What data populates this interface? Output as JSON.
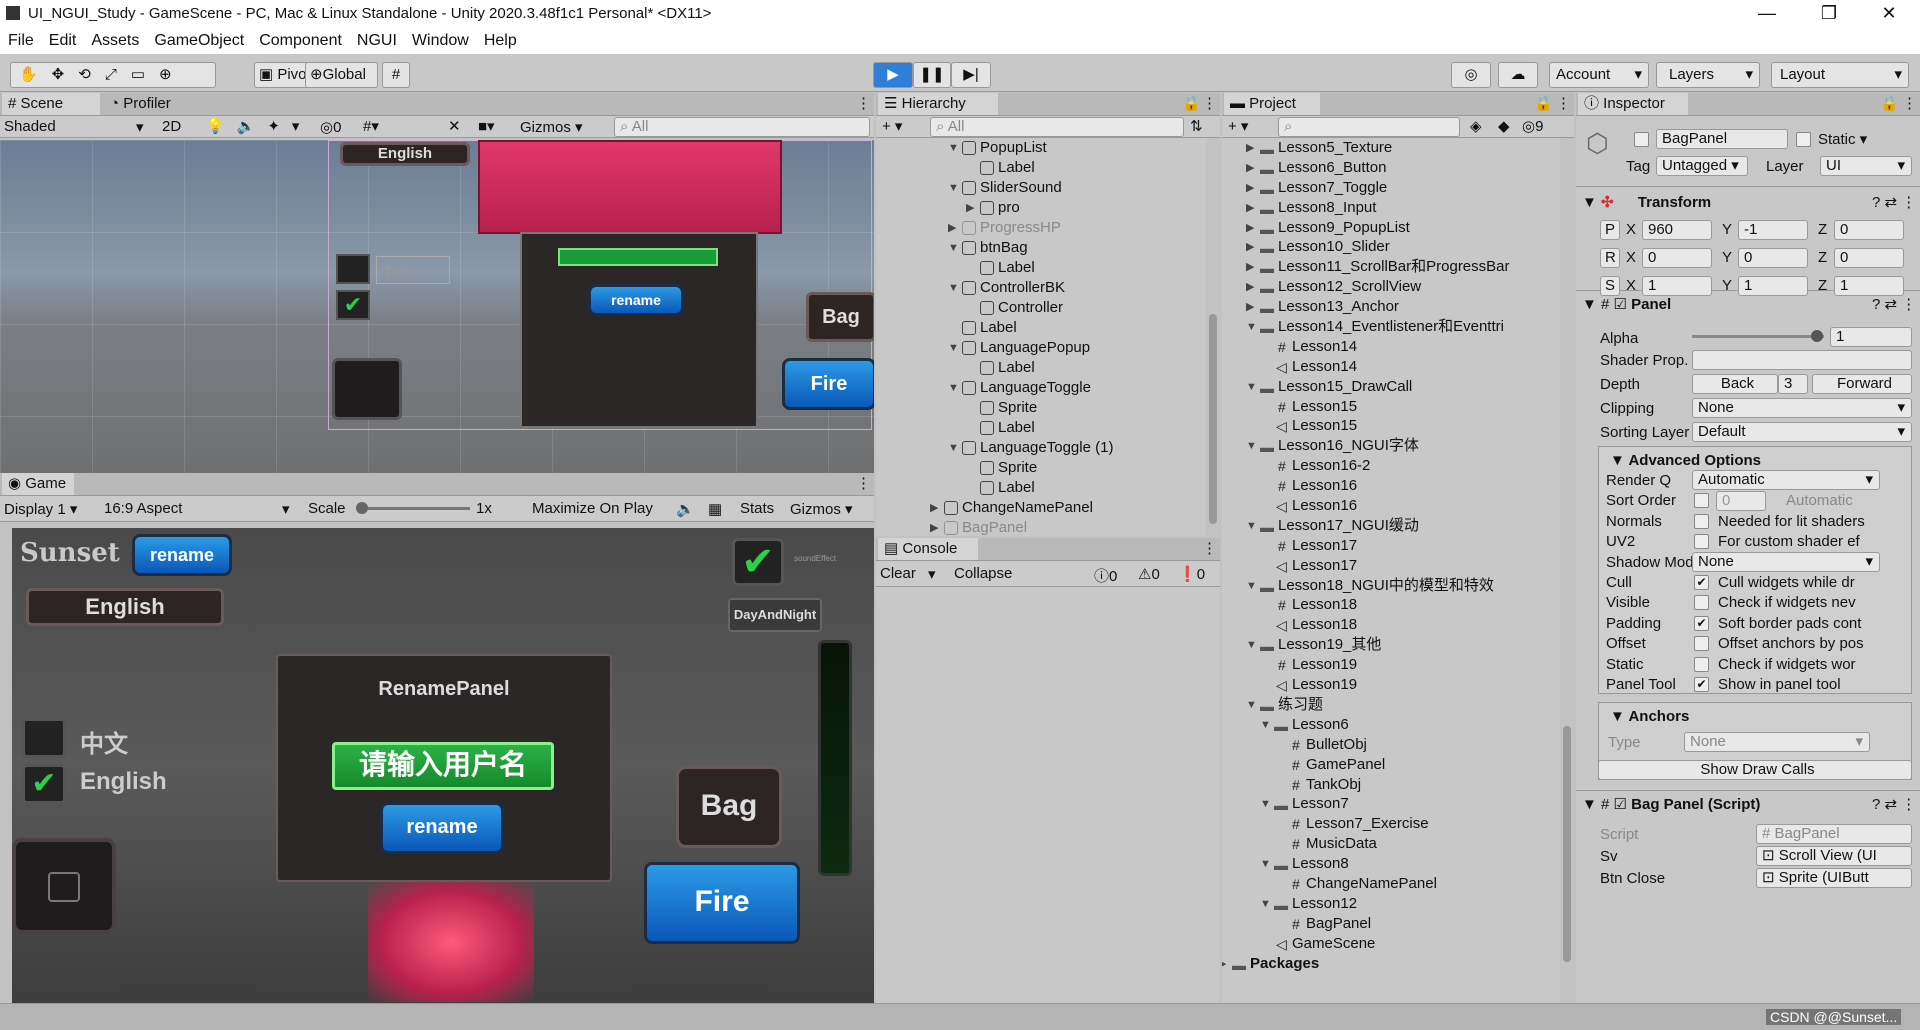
{
  "window": {
    "title": "UI_NGUI_Study - GameScene - PC, Mac & Linux Standalone - Unity 2020.3.48f1c1 Personal* <DX11>"
  },
  "menu": [
    "File",
    "Edit",
    "Assets",
    "GameObject",
    "Component",
    "NGUI",
    "Window",
    "Help"
  ],
  "toolbar": {
    "pivot": "Pivot",
    "global": "Global",
    "account": "Account",
    "layers": "Layers",
    "layout": "Layout"
  },
  "scene": {
    "tab_scene": "Scene",
    "tab_profiler": "Profiler",
    "shading": "Shaded",
    "mode2d": "2D",
    "gizmos": "Gizmos",
    "search": "All",
    "hidden_count": "0"
  },
  "game": {
    "tab": "Game",
    "display": "Display 1",
    "aspect": "16:9 Aspect",
    "scale": "Scale",
    "scale_val": "1x",
    "maximize": "Maximize On Play",
    "stats": "Stats",
    "gizmos": "Gizmos"
  },
  "gameui": {
    "sunset": "Sunset",
    "rename": "rename",
    "english": "English",
    "chinese": "中文",
    "rename_panel": "RenamePanel",
    "input": "请输入用户名",
    "bag": "Bag",
    "fire": "Fire",
    "sound": "soundEffect",
    "daynight": "DayAndNight"
  },
  "hierarchy": {
    "tab": "Hierarchy",
    "search": "All",
    "items": [
      {
        "d": 2,
        "t": "PopupList",
        "a": "v"
      },
      {
        "d": 3,
        "t": "Label",
        "a": ""
      },
      {
        "d": 2,
        "t": "SliderSound",
        "a": "v"
      },
      {
        "d": 3,
        "t": "pro",
        "a": ">"
      },
      {
        "d": 2,
        "t": "ProgressHP",
        "a": ">",
        "dim": true
      },
      {
        "d": 2,
        "t": "btnBag",
        "a": "v"
      },
      {
        "d": 3,
        "t": "Label",
        "a": ""
      },
      {
        "d": 2,
        "t": "ControllerBK",
        "a": "v"
      },
      {
        "d": 3,
        "t": "Controller",
        "a": ""
      },
      {
        "d": 2,
        "t": "Label",
        "a": ""
      },
      {
        "d": 2,
        "t": "LanguagePopup",
        "a": "v"
      },
      {
        "d": 3,
        "t": "Label",
        "a": ""
      },
      {
        "d": 2,
        "t": "LanguageToggle",
        "a": "v"
      },
      {
        "d": 3,
        "t": "Sprite",
        "a": ""
      },
      {
        "d": 3,
        "t": "Label",
        "a": ""
      },
      {
        "d": 2,
        "t": "LanguageToggle (1)",
        "a": "v"
      },
      {
        "d": 3,
        "t": "Sprite",
        "a": ""
      },
      {
        "d": 3,
        "t": "Label",
        "a": ""
      },
      {
        "d": 1,
        "t": "ChangeNamePanel",
        "a": ">"
      },
      {
        "d": 1,
        "t": "BagPanel",
        "a": ">",
        "dim": true
      }
    ]
  },
  "console": {
    "tab": "Console",
    "clear": "Clear",
    "collapse": "Collapse",
    "errors": "0",
    "warnings": "0",
    "logs": "0"
  },
  "project": {
    "tab": "Project",
    "hidden": "9",
    "items": [
      {
        "d": 2,
        "t": "Lesson5_Texture",
        "k": "f",
        "a": ">"
      },
      {
        "d": 2,
        "t": "Lesson6_Button",
        "k": "f",
        "a": ">"
      },
      {
        "d": 2,
        "t": "Lesson7_Toggle",
        "k": "f",
        "a": ">"
      },
      {
        "d": 2,
        "t": "Lesson8_Input",
        "k": "f",
        "a": ">"
      },
      {
        "d": 2,
        "t": "Lesson9_PopupList",
        "k": "f",
        "a": ">"
      },
      {
        "d": 2,
        "t": "Lesson10_Slider",
        "k": "f",
        "a": ">"
      },
      {
        "d": 2,
        "t": "Lesson11_ScrollBar和ProgressBar",
        "k": "f",
        "a": ">"
      },
      {
        "d": 2,
        "t": "Lesson12_ScrollView",
        "k": "f",
        "a": ">"
      },
      {
        "d": 2,
        "t": "Lesson13_Anchor",
        "k": "f",
        "a": ">"
      },
      {
        "d": 2,
        "t": "Lesson14_Eventlistener和Eventtri",
        "k": "f",
        "a": "v"
      },
      {
        "d": 3,
        "t": "Lesson14",
        "k": "s",
        "a": ""
      },
      {
        "d": 3,
        "t": "Lesson14",
        "k": "u",
        "a": ""
      },
      {
        "d": 2,
        "t": "Lesson15_DrawCall",
        "k": "f",
        "a": "v"
      },
      {
        "d": 3,
        "t": "Lesson15",
        "k": "s",
        "a": ""
      },
      {
        "d": 3,
        "t": "Lesson15",
        "k": "u",
        "a": ""
      },
      {
        "d": 2,
        "t": "Lesson16_NGUI字体",
        "k": "f",
        "a": "v"
      },
      {
        "d": 3,
        "t": "Lesson16-2",
        "k": "s",
        "a": ""
      },
      {
        "d": 3,
        "t": "Lesson16",
        "k": "s",
        "a": ""
      },
      {
        "d": 3,
        "t": "Lesson16",
        "k": "u",
        "a": ""
      },
      {
        "d": 2,
        "t": "Lesson17_NGUI缓动",
        "k": "f",
        "a": "v"
      },
      {
        "d": 3,
        "t": "Lesson17",
        "k": "s",
        "a": ""
      },
      {
        "d": 3,
        "t": "Lesson17",
        "k": "u",
        "a": ""
      },
      {
        "d": 2,
        "t": "Lesson18_NGUI中的模型和特效",
        "k": "f",
        "a": "v"
      },
      {
        "d": 3,
        "t": "Lesson18",
        "k": "s",
        "a": ""
      },
      {
        "d": 3,
        "t": "Lesson18",
        "k": "u",
        "a": ""
      },
      {
        "d": 2,
        "t": "Lesson19_其他",
        "k": "f",
        "a": "v"
      },
      {
        "d": 3,
        "t": "Lesson19",
        "k": "s",
        "a": ""
      },
      {
        "d": 3,
        "t": "Lesson19",
        "k": "u",
        "a": ""
      },
      {
        "d": 2,
        "t": "练习题",
        "k": "f",
        "a": "v"
      },
      {
        "d": 3,
        "t": "Lesson6",
        "k": "f",
        "a": "v"
      },
      {
        "d": 4,
        "t": "BulletObj",
        "k": "s",
        "a": ""
      },
      {
        "d": 4,
        "t": "GamePanel",
        "k": "s",
        "a": ""
      },
      {
        "d": 4,
        "t": "TankObj",
        "k": "s",
        "a": ""
      },
      {
        "d": 3,
        "t": "Lesson7",
        "k": "f",
        "a": "v"
      },
      {
        "d": 4,
        "t": "Lesson7_Exercise",
        "k": "s",
        "a": ""
      },
      {
        "d": 4,
        "t": "MusicData",
        "k": "s",
        "a": ""
      },
      {
        "d": 3,
        "t": "Lesson8",
        "k": "f",
        "a": "v"
      },
      {
        "d": 4,
        "t": "ChangeNamePanel",
        "k": "s",
        "a": ""
      },
      {
        "d": 3,
        "t": "Lesson12",
        "k": "f",
        "a": "v"
      },
      {
        "d": 4,
        "t": "BagPanel",
        "k": "s",
        "a": ""
      },
      {
        "d": 3,
        "t": "GameScene",
        "k": "u",
        "a": ""
      },
      {
        "d": 0,
        "t": "Packages",
        "k": "f",
        "a": ">",
        "bold": true
      }
    ]
  },
  "inspector": {
    "tab": "Inspector",
    "name": "BagPanel",
    "static": "Static",
    "tag_label": "Tag",
    "tag": "Untagged",
    "layer_label": "Layer",
    "layer": "UI",
    "transform": {
      "title": "Transform",
      "px": "960",
      "py": "-1",
      "pz": "0",
      "rx": "0",
      "ry": "0",
      "rz": "0",
      "sx": "1",
      "sy": "1",
      "sz": "1"
    },
    "panel": {
      "title": "Panel",
      "alpha": "Alpha",
      "alpha_val": "1",
      "alpha_level": 0.95,
      "shader": "Shader Prop.",
      "depth": "Depth",
      "back": "Back",
      "depth_val": "3",
      "forward": "Forward",
      "clipping": "Clipping",
      "clipping_val": "None",
      "sorting": "Sorting Layer",
      "sorting_val": "Default",
      "advanced": "Advanced Options",
      "rows": [
        {
          "k": "Render Q",
          "v": "Automatic",
          "type": "select"
        },
        {
          "k": "Sort Order",
          "v": "Automatic",
          "type": "num",
          "num": "0"
        },
        {
          "k": "Normals",
          "v": "Needed for lit shaders",
          "type": "chk",
          "on": false
        },
        {
          "k": "UV2",
          "v": "For custom shader ef",
          "type": "chk",
          "on": false
        },
        {
          "k": "Shadow Mode",
          "v": "None",
          "type": "select"
        },
        {
          "k": "Cull",
          "v": "Cull widgets while dr",
          "type": "chk",
          "on": true
        },
        {
          "k": "Visible",
          "v": "Check if widgets nev",
          "type": "chk",
          "on": false
        },
        {
          "k": "Padding",
          "v": "Soft border pads cont",
          "type": "chk",
          "on": true
        },
        {
          "k": "Offset",
          "v": "Offset anchors by pos",
          "type": "chk",
          "on": false
        },
        {
          "k": "Static",
          "v": "Check if widgets wor",
          "type": "chk",
          "on": false
        },
        {
          "k": "Panel Tool",
          "v": "Show in panel tool",
          "type": "chk",
          "on": true
        }
      ],
      "anchors": "Anchors",
      "type_label": "Type",
      "type_val": "None",
      "show_draw": "Show Draw Calls"
    },
    "bag": {
      "title": "Bag Panel (Script)",
      "script_label": "Script",
      "script_val": "BagPanel",
      "sv_label": "Sv",
      "sv_val": "Scroll View (UI",
      "btn_label": "Btn Close",
      "btn_val": "Sprite (UIButt"
    }
  },
  "watermark": "CSDN @@Sunset..."
}
